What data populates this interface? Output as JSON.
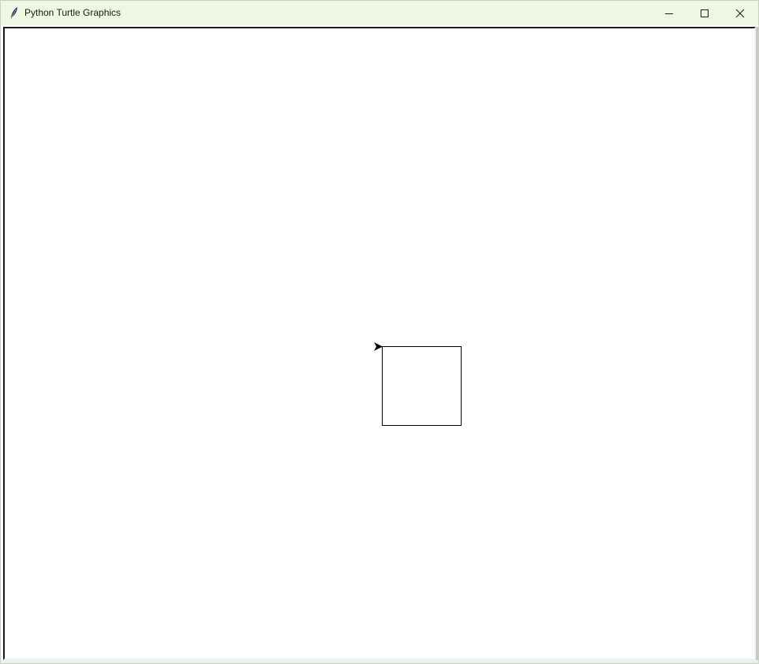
{
  "window": {
    "title": "Python Turtle Graphics",
    "titlebar_color": "#edf7e3",
    "icon": "feather-icon",
    "controls": {
      "minimize_icon": "minimize-icon",
      "maximize_icon": "maximize-icon",
      "close_icon": "close-icon"
    }
  },
  "canvas": {
    "background": "#ffffff",
    "pen_color": "#000000",
    "turtle_shape": "arrow",
    "turtle_heading": "east",
    "drawing": "square"
  }
}
